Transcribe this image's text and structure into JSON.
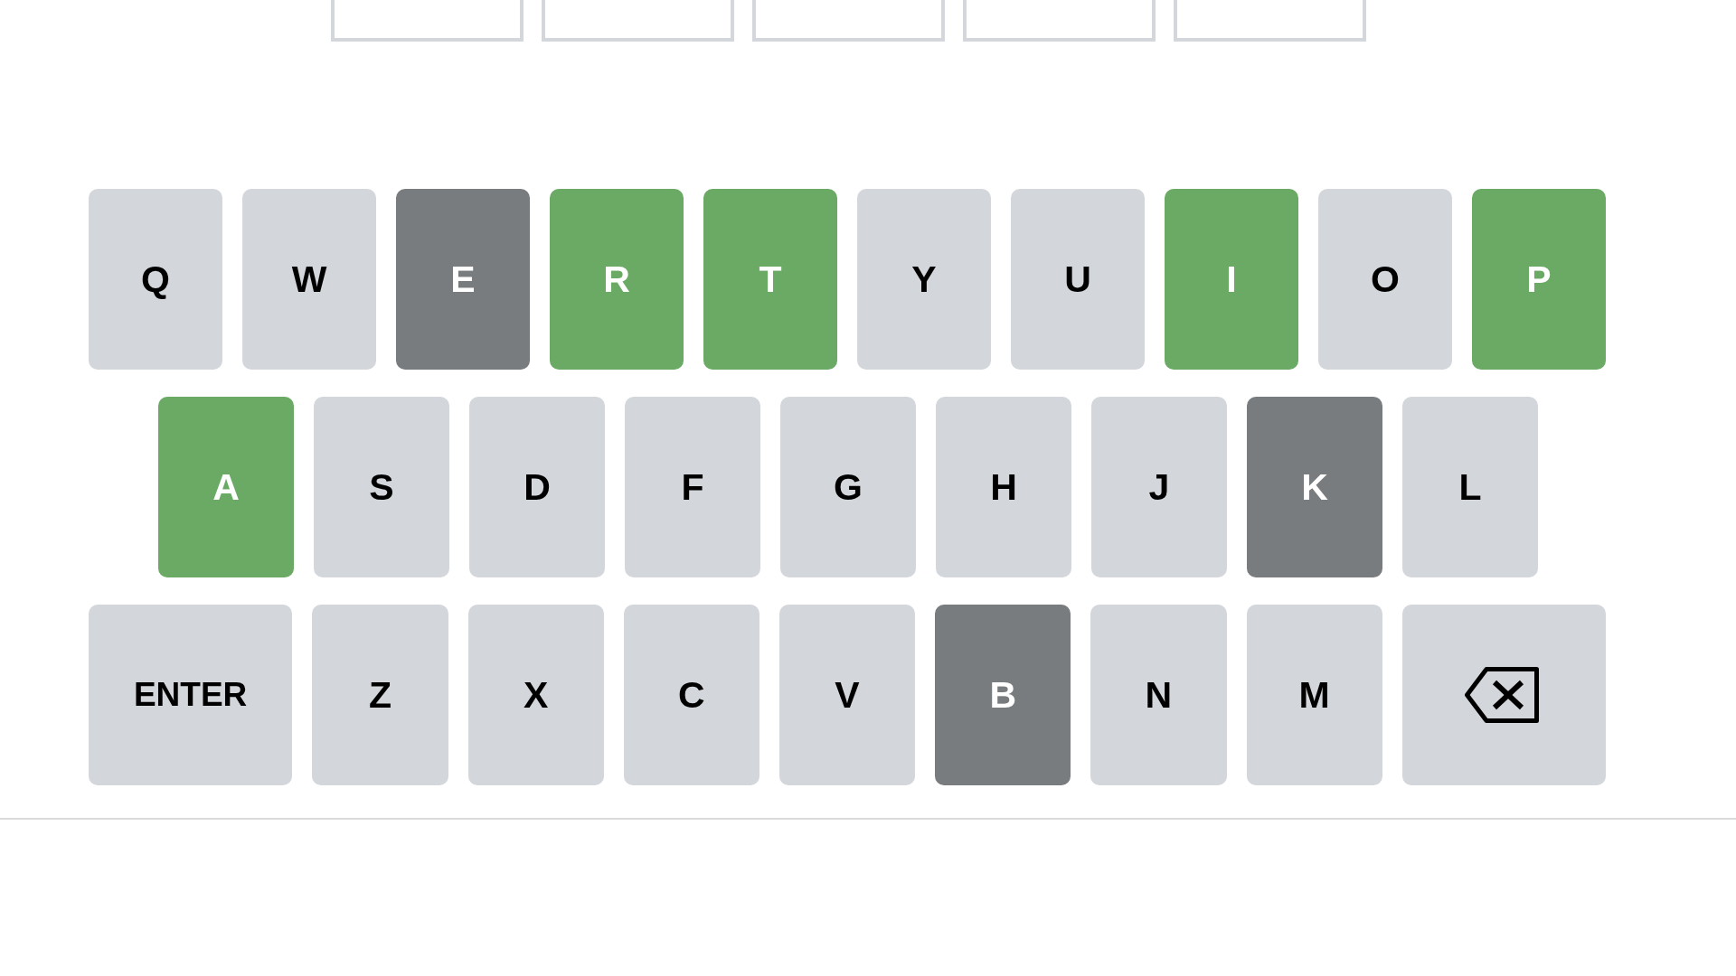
{
  "board": {
    "tiles": [
      {
        "filled": false
      },
      {
        "filled": false
      },
      {
        "filled": false
      },
      {
        "filled": false
      },
      {
        "filled": false
      }
    ]
  },
  "keyboard": {
    "rows": [
      {
        "keys": [
          {
            "kind": "letter",
            "label": "Q",
            "color": "#d3d6da"
          },
          {
            "kind": "letter",
            "label": "W",
            "color": "#d3d6da"
          },
          {
            "kind": "letter",
            "label": "E",
            "color": "#787c7e"
          },
          {
            "kind": "letter",
            "label": "R",
            "color": "#6aaa64"
          },
          {
            "kind": "letter",
            "label": "T",
            "color": "#6aaa64"
          },
          {
            "kind": "letter",
            "label": "Y",
            "color": "#d3d6da"
          },
          {
            "kind": "letter",
            "label": "U",
            "color": "#d3d6da"
          },
          {
            "kind": "letter",
            "label": "I",
            "color": "#6aaa64"
          },
          {
            "kind": "letter",
            "label": "O",
            "color": "#d3d6da"
          },
          {
            "kind": "letter",
            "label": "P",
            "color": "#6aaa64"
          }
        ]
      },
      {
        "keys": [
          {
            "kind": "letter",
            "label": "A",
            "color": "#6aaa64"
          },
          {
            "kind": "letter",
            "label": "S",
            "color": "#d3d6da"
          },
          {
            "kind": "letter",
            "label": "D",
            "color": "#d3d6da"
          },
          {
            "kind": "letter",
            "label": "F",
            "color": "#d3d6da"
          },
          {
            "kind": "letter",
            "label": "G",
            "color": "#d3d6da"
          },
          {
            "kind": "letter",
            "label": "H",
            "color": "#d3d6da"
          },
          {
            "kind": "letter",
            "label": "J",
            "color": "#d3d6da"
          },
          {
            "kind": "letter",
            "label": "K",
            "color": "#787c7e"
          },
          {
            "kind": "letter",
            "label": "L",
            "color": "#d3d6da"
          }
        ]
      },
      {
        "keys": [
          {
            "kind": "enter",
            "label": "ENTER",
            "color": "#d3d6da"
          },
          {
            "kind": "letter",
            "label": "Z",
            "color": "#d3d6da"
          },
          {
            "kind": "letter",
            "label": "X",
            "color": "#d3d6da"
          },
          {
            "kind": "letter",
            "label": "C",
            "color": "#d3d6da"
          },
          {
            "kind": "letter",
            "label": "V",
            "color": "#d3d6da"
          },
          {
            "kind": "letter",
            "label": "B",
            "color": "#787c7e"
          },
          {
            "kind": "letter",
            "label": "N",
            "color": "#d3d6da"
          },
          {
            "kind": "letter",
            "label": "M",
            "color": "#d3d6da"
          },
          {
            "kind": "backspace",
            "color": "#d3d6da"
          }
        ]
      }
    ]
  }
}
